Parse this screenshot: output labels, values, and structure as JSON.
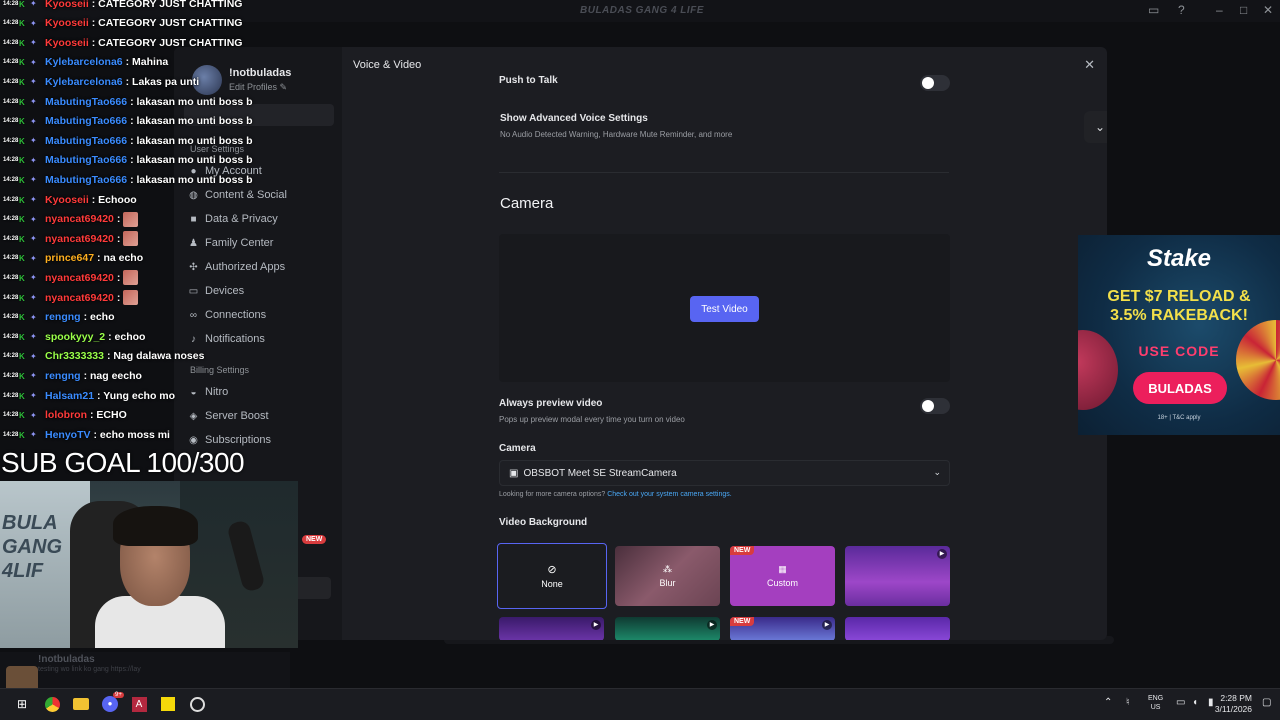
{
  "window": {
    "title": "BULADAS GANG 4 LIFE",
    "minimize_icon": "minimize-icon",
    "maximize_icon": "maximize-icon",
    "close_icon": "close-icon"
  },
  "settings": {
    "profile": {
      "name": "!notbuladas",
      "edit_label": "Edit Profiles"
    },
    "sections": {
      "user": "User Settings",
      "billing": "Billing Settings"
    },
    "user_items": [
      {
        "label": "My Account",
        "icon": "user-icon"
      },
      {
        "label": "Content & Social",
        "icon": "social-icon"
      },
      {
        "label": "Data & Privacy",
        "icon": "lock-icon"
      },
      {
        "label": "Family Center",
        "icon": "family-icon"
      },
      {
        "label": "Authorized Apps",
        "icon": "apps-icon"
      },
      {
        "label": "Devices",
        "icon": "devices-icon"
      },
      {
        "label": "Connections",
        "icon": "link-icon"
      },
      {
        "label": "Notifications",
        "icon": "bell-icon"
      }
    ],
    "billing_items": [
      {
        "label": "Nitro",
        "icon": "nitro-icon"
      },
      {
        "label": "Server Boost",
        "icon": "boost-icon"
      },
      {
        "label": "Subscriptions",
        "icon": "subscriptions-icon"
      }
    ],
    "page_title": "Voice & Video",
    "push_to_talk": "Push to Talk",
    "advanced": {
      "title": "Show Advanced Voice Settings",
      "subtitle": "No Audio Detected Warning, Hardware Mute Reminder, and more"
    },
    "camera_heading": "Camera",
    "test_video_label": "Test Video",
    "always_preview": {
      "title": "Always preview video",
      "subtitle": "Pops up preview modal every time you turn on video"
    },
    "camera_select": {
      "label": "Camera",
      "value": "OBSBOT Meet SE StreamCamera",
      "help_prefix": "Looking for more camera options?",
      "help_link": "Check out your system camera settings."
    },
    "video_background": {
      "label": "Video Background",
      "tiles": [
        {
          "label": "None",
          "icon": "none-icon",
          "selected": true,
          "badge": ""
        },
        {
          "label": "Blur",
          "icon": "blur-icon",
          "selected": false,
          "badge": ""
        },
        {
          "label": "Custom",
          "icon": "custom-icon",
          "selected": false,
          "badge": "NEW"
        },
        {
          "label": "",
          "icon": "play-icon",
          "selected": false,
          "badge": ""
        }
      ],
      "row2_badge": "NEW"
    }
  },
  "chat": {
    "time": "14:28",
    "lines": [
      {
        "user": "Kyooseii",
        "msg": ": CATEGORY JUST CHATTING",
        "color": "#ff3b3b"
      },
      {
        "user": "Kyooseii",
        "msg": ": CATEGORY JUST CHATTING",
        "color": "#ff3b3b"
      },
      {
        "user": "Kyooseii",
        "msg": ": CATEGORY JUST CHATTING",
        "color": "#ff3b3b"
      },
      {
        "user": "Kylebarcelona6",
        "msg": ": Mahina",
        "color": "#3b8cff"
      },
      {
        "user": "Kylebarcelona6",
        "msg": ": Lakas pa unti",
        "color": "#3b8cff"
      },
      {
        "user": "MabutingTao666",
        "msg": ": lakasan mo unti boss b",
        "color": "#3b8cff"
      },
      {
        "user": "MabutingTao666",
        "msg": ": lakasan mo unti boss b",
        "color": "#3b8cff"
      },
      {
        "user": "MabutingTao666",
        "msg": ": lakasan mo unti boss b",
        "color": "#3b8cff"
      },
      {
        "user": "MabutingTao666",
        "msg": ": lakasan mo unti boss b",
        "color": "#3b8cff"
      },
      {
        "user": "MabutingTao666",
        "msg": ": lakasan mo unti boss b",
        "color": "#3b8cff"
      },
      {
        "user": "Kyooseii",
        "msg": ": Echooo",
        "color": "#ff3b3b"
      },
      {
        "user": "nyancat69420",
        "msg": ":",
        "color": "#ff3b3b",
        "emote": true
      },
      {
        "user": "nyancat69420",
        "msg": ":",
        "color": "#ff3b3b",
        "emote": true
      },
      {
        "user": "prince647",
        "msg": ": na echo",
        "color": "#ffb020"
      },
      {
        "user": "nyancat69420",
        "msg": ":",
        "color": "#ff3b3b",
        "emote": true
      },
      {
        "user": "nyancat69420",
        "msg": ":",
        "color": "#ff3b3b",
        "emote": true
      },
      {
        "user": "rengng",
        "msg": ": echo",
        "color": "#3b8cff"
      },
      {
        "user": "spookyyy_2",
        "msg": ": echoo",
        "color": "#9aff4a"
      },
      {
        "user": "Chr3333333",
        "msg": ": Nag dalawa noses",
        "color": "#9aff4a"
      },
      {
        "user": "rengng",
        "msg": ": nag eecho",
        "color": "#3b8cff"
      },
      {
        "user": "Halsam21",
        "msg": ": Yung echo mo",
        "color": "#3b8cff"
      },
      {
        "user": "lolobron",
        "msg": ": ECHO",
        "color": "#ff3b3b"
      },
      {
        "user": "HenyoTV",
        "msg": ": echo moss mi",
        "color": "#3b8cff"
      }
    ],
    "sub_goal": "SUB GOAL 100/300"
  },
  "webcam": {
    "new_badge": "NEW"
  },
  "ad": {
    "brand": "Stake",
    "headline_1": "GET $7 RELOAD &",
    "headline_2": "3.5% RAKEBACK!",
    "use_code": "USE CODE",
    "code": "BULADAS",
    "fine_print": "18+ | T&C apply"
  },
  "user_bar": {
    "name": "!notbuladas",
    "status": "testing wo link ko gang https://lay"
  },
  "taskbar": {
    "apps": [
      "start-icon",
      "chrome-icon",
      "explorer-icon",
      "discord-icon",
      "app-icon",
      "notes-icon",
      "obs-icon"
    ],
    "discord_badge": "9+",
    "lang_1": "ENG",
    "lang_2": "US",
    "time": "2:28 PM",
    "date": "3/11/2026"
  }
}
